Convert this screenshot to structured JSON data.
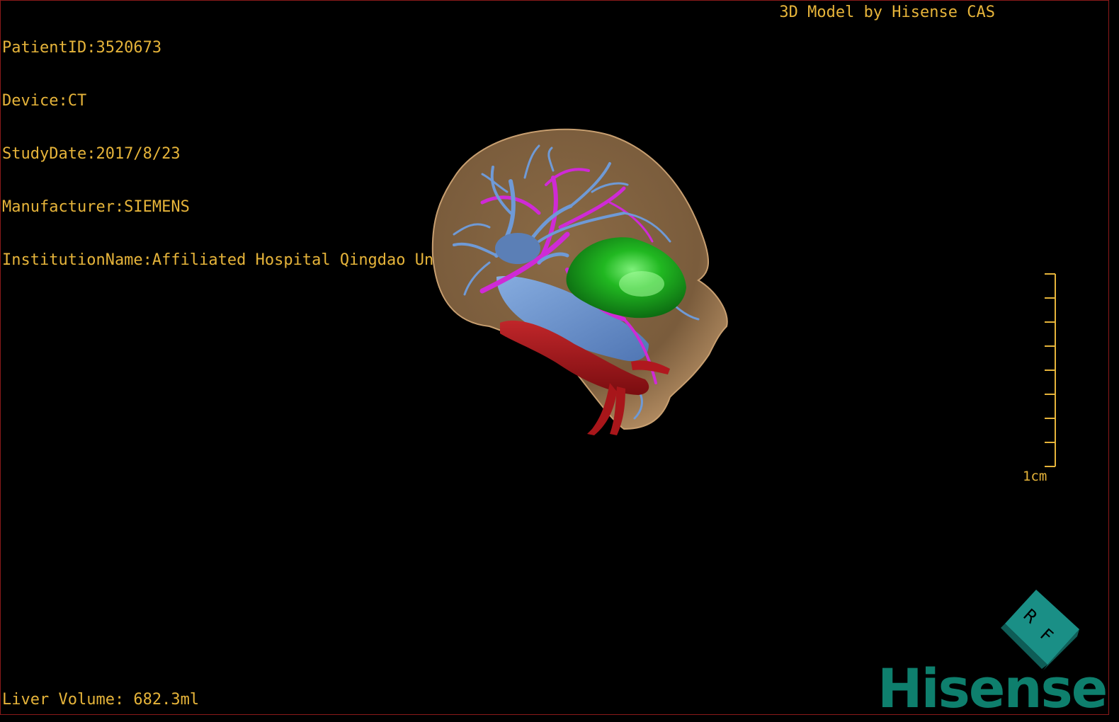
{
  "overlay": {
    "patient_id": "PatientID:3520673",
    "device": "Device:CT",
    "study_date": "StudyDate:2017/8/23",
    "manufacturer": "Manufacturer:SIEMENS",
    "institution": "InstitutionName:Affiliated Hospital Qingdao University-C",
    "model_credit": "3D Model by Hisense CAS",
    "liver_volume": "Liver Volume: 682.3ml"
  },
  "scale_bar": {
    "label": "1cm"
  },
  "orientation_cube": {
    "face_letters": [
      "R",
      "F"
    ],
    "color": "#1a8f86"
  },
  "logo": {
    "text": "Hisense",
    "color": "#0e7f6d"
  },
  "colors": {
    "overlay_text": "#e6b43a",
    "liver": "#a8845c",
    "hepatic_vein": "#6f9ad6",
    "portal_vein": "#cf2ad6",
    "artery": "#b0181e",
    "tumor": "#2fbf2f",
    "vena_cava": "#6d96d0"
  }
}
